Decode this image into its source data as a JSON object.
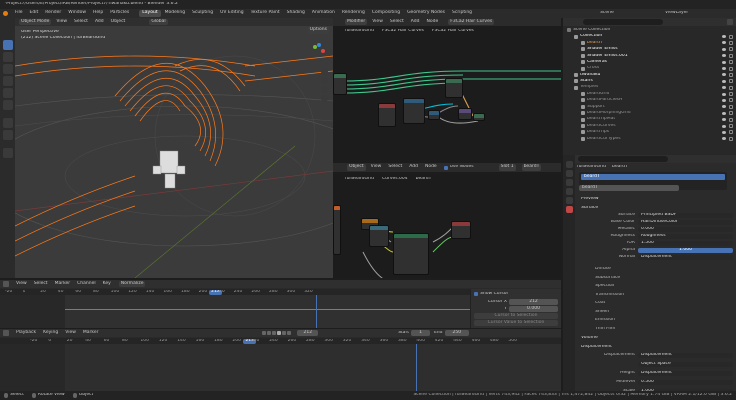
{
  "window": {
    "title": "*Project7/Users/E/Project/IRB/Render/Project7/Tiwanaku.blend - Blender 3.6.2"
  },
  "topmenu": {
    "items": [
      "File",
      "Edit",
      "Render",
      "Window",
      "Help",
      "Particles"
    ],
    "workspaces": [
      "Layout",
      "Modeling",
      "Sculpting",
      "UV Editing",
      "Texture Paint",
      "Shading",
      "Animation",
      "Rendering",
      "Compositing",
      "Geometry Nodes",
      "Scripting"
    ],
    "active_workspace": "Layout",
    "scene": "Scene",
    "view_layer": "ViewLayer"
  },
  "viewport": {
    "mode": "Object Mode",
    "menus": [
      "View",
      "Select",
      "Add",
      "Object"
    ],
    "transform": "Global",
    "options": "Options",
    "title": "User Perspective",
    "subtitle": "(212) Scene Collection | furBeardGrid"
  },
  "node_editor_top": {
    "type": "Modifier",
    "menus": [
      "View",
      "Select",
      "Add",
      "Node"
    ],
    "node_group": "F3Ca2 Hair Curves",
    "breadcrumb": [
      "furBeardGrid",
      "F3Ca2 Hair Curves",
      "F3Ca2 Hair Curves"
    ]
  },
  "node_editor_bottom": {
    "type": "Object",
    "menus": [
      "View",
      "Select",
      "Add",
      "Node"
    ],
    "use_nodes": "Use Nodes",
    "slot": "Slot 1",
    "material": "beardT",
    "breadcrumb": [
      "furBeardGrid",
      "Curves.004",
      "beardT"
    ]
  },
  "outliner": {
    "items": [
      {
        "label": "Scene Collection",
        "level": 0,
        "color": "#bbbbbb"
      },
      {
        "label": "Collection",
        "level": 1,
        "color": "#ffffff"
      },
      {
        "label": "beardT",
        "level": 2,
        "color": "#e9a150"
      },
      {
        "label": "Shader Emiss",
        "level": 2,
        "color": "#ffffff"
      },
      {
        "label": "Shader Emiss.001",
        "level": 2,
        "color": "#ffffff"
      },
      {
        "label": "Cameras",
        "level": 2,
        "color": "#ffffff"
      },
      {
        "label": "Cross",
        "level": 2,
        "color": "#999999"
      },
      {
        "label": "tiwanaku",
        "level": 1,
        "color": "#ffffff"
      },
      {
        "label": "Stairs",
        "level": 1,
        "color": "#ffffff"
      },
      {
        "label": "Temples",
        "level": 1,
        "color": "#999999"
      },
      {
        "label": "beardGrid",
        "level": 2,
        "color": "#999999"
      },
      {
        "label": "beardParticlesH",
        "level": 2,
        "color": "#999999"
      },
      {
        "label": "Support",
        "level": 2,
        "color": "#999999"
      },
      {
        "label": "beardMorphingGrid",
        "level": 2,
        "color": "#999999"
      },
      {
        "label": "beardTipMat",
        "level": 2,
        "color": "#999999"
      },
      {
        "label": "beardCurves",
        "level": 2,
        "color": "#999999"
      },
      {
        "label": "beardTips",
        "level": 2,
        "color": "#999999"
      },
      {
        "label": "beardCurTypes",
        "level": 2,
        "color": "#999999"
      }
    ]
  },
  "properties": {
    "breadcrumb": [
      "furBeardGrid",
      "beardT"
    ],
    "slot_item": "beardT",
    "material_field": "beardT",
    "preview": "Preview",
    "surface": "Surface",
    "rows": [
      {
        "label": "Surface",
        "value": "Principled BSDF",
        "style": "plain"
      },
      {
        "label": "Base Color",
        "value": "HairDiffuseColor",
        "style": "plain"
      },
      {
        "label": "Metallic",
        "value": "0.000",
        "style": "plain"
      },
      {
        "label": "Roughness",
        "value": "Roughness",
        "style": "plain"
      },
      {
        "label": "IOR",
        "value": "1.500",
        "style": "plain"
      },
      {
        "label": "Alpha",
        "value": "1.000",
        "style": "blue"
      },
      {
        "label": "Normal",
        "value": "Displacement",
        "style": "plain"
      }
    ],
    "sections": [
      "Diffuse",
      "Subsurface",
      "Specular",
      "Transmission",
      "Coat",
      "Sheen",
      "Emission",
      "Thin Film"
    ],
    "volume": "Volume",
    "displacement": "Displacement",
    "disp_rows": [
      {
        "label": "Displacement",
        "value": "Displacement"
      },
      {
        "label": "",
        "value": "Object Space"
      },
      {
        "label": "Height",
        "value": "Displacement"
      },
      {
        "label": "Midlevel",
        "value": "0.500"
      },
      {
        "label": "Scale",
        "value": "1.000"
      }
    ]
  },
  "graph_editor": {
    "menus": [
      "View",
      "Select",
      "Marker",
      "Channel",
      "Key"
    ],
    "normalize": "Normalize",
    "ticks": [
      "-20",
      "0",
      "20",
      "40",
      "60",
      "80",
      "100",
      "120",
      "140",
      "160",
      "180",
      "200",
      "212",
      "220",
      "240",
      "260",
      "280",
      "300",
      "320",
      "340",
      "360",
      "380",
      "400",
      "420",
      "440",
      "460",
      "480",
      "500"
    ],
    "current_frame": "212",
    "panel": {
      "title": "Show Cursor",
      "cursor_x_label": "Cursor X",
      "cursor_x": "212",
      "y_label": "Y",
      "y": "0.000",
      "button1": "Cursor to Selection",
      "button2": "Cursor Value to Selection"
    }
  },
  "timeline": {
    "menus": [
      "Playback",
      "Keying",
      "View",
      "Marker"
    ],
    "current_frame": "212",
    "start_label": "Start",
    "start": "1",
    "end_label": "End",
    "end": "250",
    "ticks": [
      "-20",
      "0",
      "20",
      "40",
      "60",
      "80",
      "100",
      "120",
      "140",
      "160",
      "180",
      "200",
      "212",
      "220",
      "240",
      "260",
      "280",
      "300",
      "320",
      "340",
      "360",
      "380",
      "400",
      "420",
      "440",
      "460",
      "480",
      "500"
    ]
  },
  "status": {
    "left": [
      "Select",
      "Rotate View",
      "Object"
    ],
    "right": "Scene Collection | furBeardGrid | Verts 743,942 | Faces 743,833 | Tris 1,472,842 | Objects 0/32 | Memory 1.74 GiB | VRAM 2.1/12.0 GiB | 3.6.2"
  },
  "colors": {
    "accent": "#4772b3",
    "selection": "#ff7a1a",
    "header_bg": "#2b2b2b",
    "panel_bg": "#303030",
    "playhead": "#4772b3"
  }
}
